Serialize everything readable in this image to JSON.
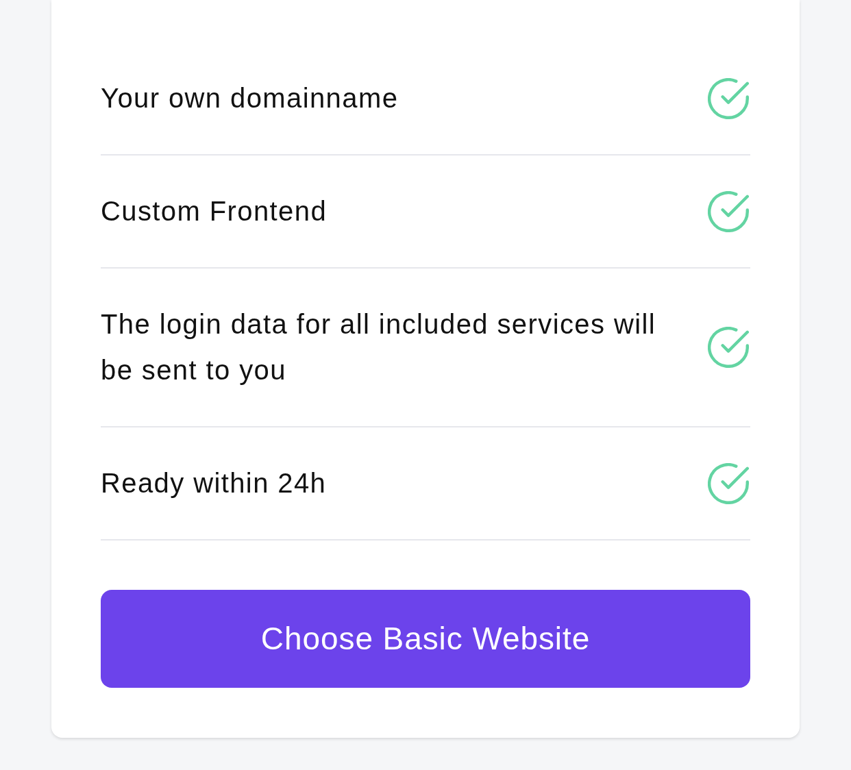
{
  "features": [
    {
      "label": "Your own domainname",
      "included": true
    },
    {
      "label": "Custom Frontend",
      "included": true
    },
    {
      "label": "The login data for all included services will be sent to you",
      "included": true
    },
    {
      "label": "Ready within 24h",
      "included": true
    }
  ],
  "button": {
    "label": "Choose Basic Website"
  }
}
